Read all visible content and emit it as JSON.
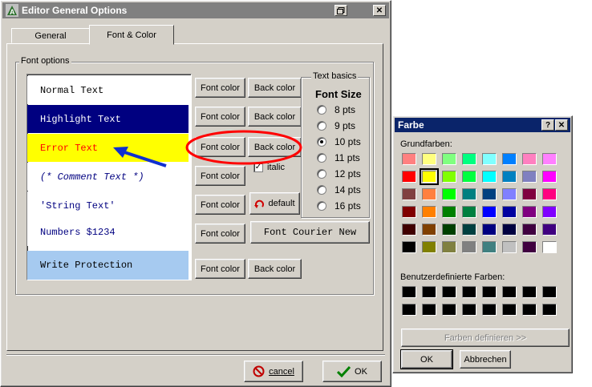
{
  "editor": {
    "title": "Editor General Options",
    "tabs": [
      "General",
      "Font & Color"
    ],
    "active_tab": "Font & Color",
    "font_options_label": "Font options",
    "samples": [
      {
        "text": "Normal Text",
        "bg": "#ffffff",
        "fg": "#000000",
        "italic": false
      },
      {
        "text": "Highlight Text",
        "bg": "#000080",
        "fg": "#ffffff",
        "italic": false
      },
      {
        "text": "Error Text",
        "bg": "#ffff00",
        "fg": "#ff0000",
        "italic": false
      },
      {
        "text": "(* Comment Text *)",
        "bg": "#ffffff",
        "fg": "#000080",
        "italic": true
      },
      {
        "text": "'String Text'",
        "bg": "#ffffff",
        "fg": "#000080",
        "italic": false
      },
      {
        "text": "Numbers $1234",
        "bg": "#ffffff",
        "fg": "#000080",
        "italic": false
      },
      {
        "text": "Write Protection",
        "bg": "#a6caf0",
        "fg": "#000000",
        "italic": false
      }
    ],
    "font_color_label": "Font color",
    "back_color_label": "Back color",
    "italic_label": "italic",
    "italic_checked": true,
    "default_label": "default",
    "font_button_label": "Font Courier New",
    "text_basics_label": "Text basics",
    "font_size_label": "Font Size",
    "font_sizes": [
      "8 pts",
      "9 pts",
      "10 pts",
      "11 pts",
      "12 pts",
      "14 pts",
      "16 pts"
    ],
    "selected_font_size": "10 pts",
    "cancel_label": "cancel",
    "ok_label": "OK"
  },
  "farbe": {
    "title": "Farbe",
    "help_glyph": "?",
    "basic_colors_label": "Grundfarben:",
    "basic_colors": [
      "#ff8080",
      "#ffff80",
      "#80ff80",
      "#00ff80",
      "#80ffff",
      "#0080ff",
      "#ff80c0",
      "#ff80ff",
      "#ff0000",
      "#ffff00",
      "#80ff00",
      "#00ff40",
      "#00ffff",
      "#0080c0",
      "#8080c0",
      "#ff00ff",
      "#804040",
      "#ff8040",
      "#00ff00",
      "#008080",
      "#004080",
      "#8080ff",
      "#800040",
      "#ff0080",
      "#800000",
      "#ff8000",
      "#008000",
      "#008040",
      "#0000ff",
      "#0000a0",
      "#800080",
      "#8000ff",
      "#400000",
      "#804000",
      "#004000",
      "#004040",
      "#000080",
      "#000040",
      "#400040",
      "#400080",
      "#000000",
      "#808000",
      "#808040",
      "#808080",
      "#408080",
      "#c0c0c0",
      "#400040",
      "#ffffff"
    ],
    "selected_index": 9,
    "custom_colors_label": "Benutzerdefinierte Farben:",
    "custom_colors": [
      "#000000",
      "#000000",
      "#000000",
      "#000000",
      "#000000",
      "#000000",
      "#000000",
      "#000000",
      "#000000",
      "#000000",
      "#000000",
      "#000000",
      "#000000",
      "#000000",
      "#000000",
      "#000000"
    ],
    "define_label": "Farben definieren >>",
    "ok_label": "OK",
    "cancel_label": "Abbrechen"
  }
}
